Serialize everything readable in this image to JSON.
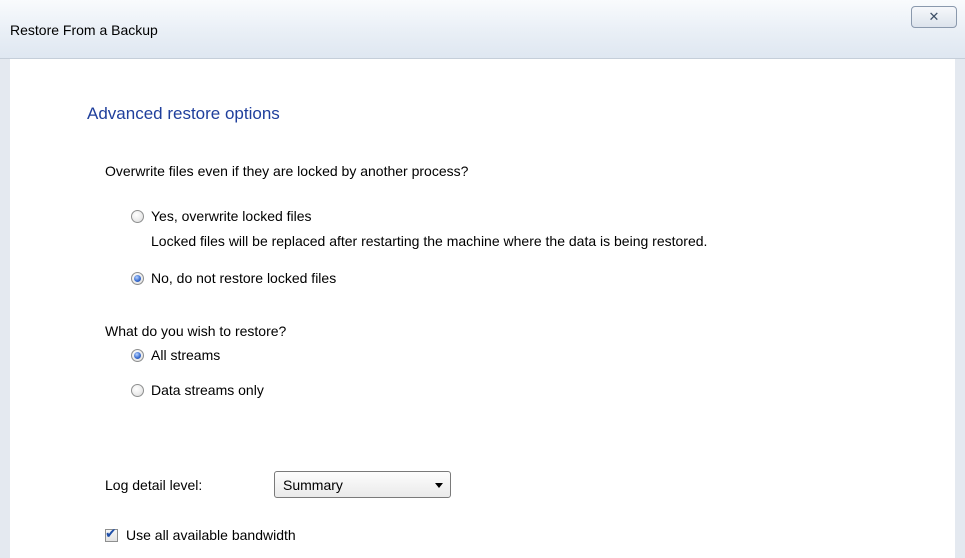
{
  "window": {
    "title": "Restore From a Backup",
    "close_glyph": "✕"
  },
  "main": {
    "heading": "Advanced restore options",
    "overwrite": {
      "question": "Overwrite files even if they are locked by another process?",
      "options": [
        {
          "label": "Yes, overwrite locked files",
          "description": "Locked files will be replaced after restarting the machine where the data is being restored.",
          "checked": false
        },
        {
          "label": "No, do not restore locked files",
          "checked": true
        }
      ]
    },
    "restore": {
      "question": "What do you wish to restore?",
      "options": [
        {
          "label": "All streams",
          "checked": true
        },
        {
          "label": "Data streams only",
          "checked": false
        }
      ]
    },
    "log": {
      "label": "Log detail level:",
      "selected": "Summary"
    },
    "bandwidth": {
      "label": "Use all available bandwidth",
      "checked": true,
      "check_glyph": "✔"
    }
  },
  "colors": {
    "heading": "#1f3f9c",
    "radio_selected": "#3c6fd1",
    "frame": "#e4e9f0"
  }
}
